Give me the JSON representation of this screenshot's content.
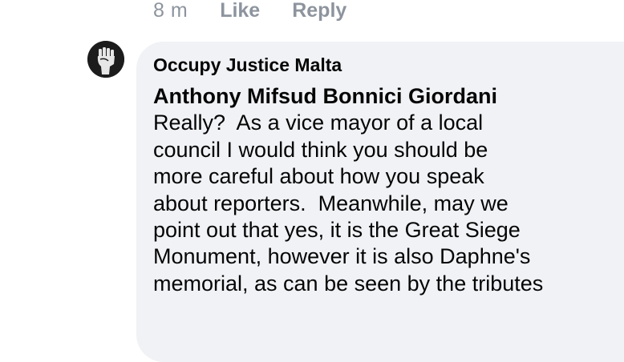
{
  "reply_meta": {
    "time": "8 m",
    "like_label": "Like",
    "reply_label": "Reply"
  },
  "comment": {
    "author": "Occupy Justice Malta",
    "mention": "Anthony Mifsud Bonnici Giordani",
    "lines": [
      "Really?  As a vice mayor of a local",
      "council I would think you should be",
      "more careful about how you speak",
      "about reporters.  Meanwhile, may we",
      "point out that yes, it is the Great Siege",
      "Monument, however it is also Daphne's",
      "memorial, as can be seen by the tributes"
    ]
  },
  "avatar_icon": "raised-fist-icon"
}
